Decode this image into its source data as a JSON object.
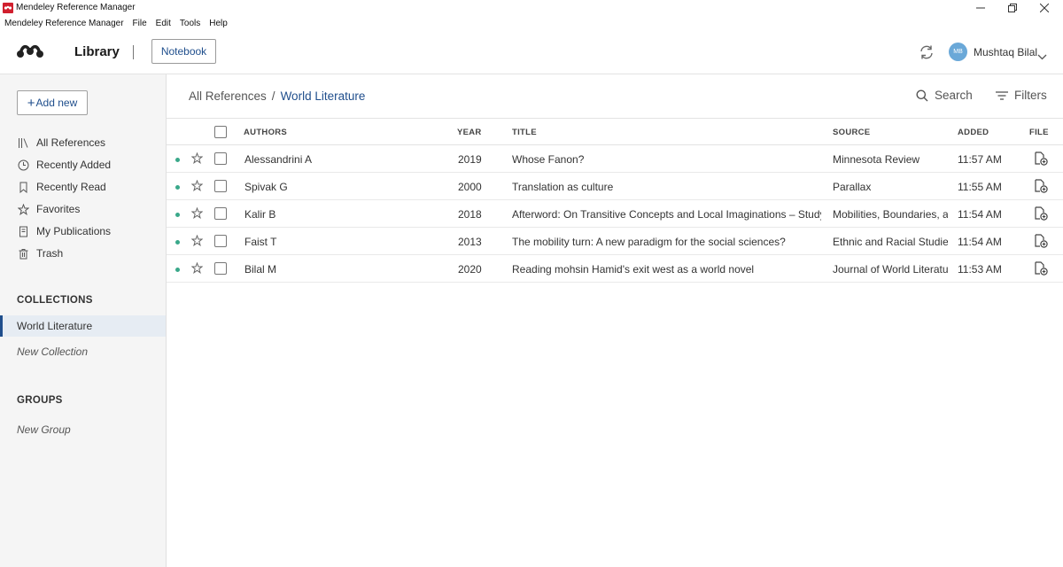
{
  "window": {
    "title": "Mendeley Reference Manager"
  },
  "menu": {
    "items": [
      "Mendeley Reference Manager",
      "File",
      "Edit",
      "Tools",
      "Help"
    ]
  },
  "header": {
    "library_label": "Library",
    "notebook_label": "Notebook",
    "user_initials": "MB",
    "user_name": "Mushtaq Bilal"
  },
  "sidebar": {
    "add_new_label": "Add new",
    "nav": [
      {
        "label": "All References",
        "icon": "library-icon"
      },
      {
        "label": "Recently Added",
        "icon": "clock-icon"
      },
      {
        "label": "Recently Read",
        "icon": "bookmark-icon"
      },
      {
        "label": "Favorites",
        "icon": "star-icon"
      },
      {
        "label": "My Publications",
        "icon": "document-icon"
      },
      {
        "label": "Trash",
        "icon": "trash-icon"
      }
    ],
    "collections_title": "COLLECTIONS",
    "collections": [
      "World Literature"
    ],
    "new_collection_label": "New Collection",
    "groups_title": "GROUPS",
    "new_group_label": "New Group"
  },
  "main": {
    "breadcrumb_root": "All References",
    "breadcrumb_sep": "/",
    "breadcrumb_current": "World Literature",
    "search_label": "Search",
    "filters_label": "Filters",
    "columns": {
      "authors": "AUTHORS",
      "year": "YEAR",
      "title": "TITLE",
      "source": "SOURCE",
      "added": "ADDED",
      "file": "FILE"
    },
    "rows": [
      {
        "authors": "Alessandrini A",
        "year": "2019",
        "title": "Whose Fanon?",
        "source": "Minnesota Review",
        "added": "11:57 AM"
      },
      {
        "authors": "Spivak G",
        "year": "2000",
        "title": "Translation as culture",
        "source": "Parallax",
        "added": "11:55 AM"
      },
      {
        "authors": "Kalir B",
        "year": "2018",
        "title": "Afterword: On Transitive Concepts and Local Imaginations – Studying M",
        "source": "Mobilities, Boundaries, and",
        "added": "11:54 AM"
      },
      {
        "authors": "Faist T",
        "year": "2013",
        "title": "The mobility turn: A new paradigm for the social sciences?",
        "source": "Ethnic and Racial Studies",
        "added": "11:54 AM"
      },
      {
        "authors": "Bilal M",
        "year": "2020",
        "title": "Reading mohsin Hamid's exit west as a world novel",
        "source": "Journal of World Literature",
        "added": "11:53 AM"
      }
    ]
  },
  "colors": {
    "accent": "#1f4e8c",
    "unread_dot": "#3aa88a",
    "brand_red": "#d11f2e"
  }
}
